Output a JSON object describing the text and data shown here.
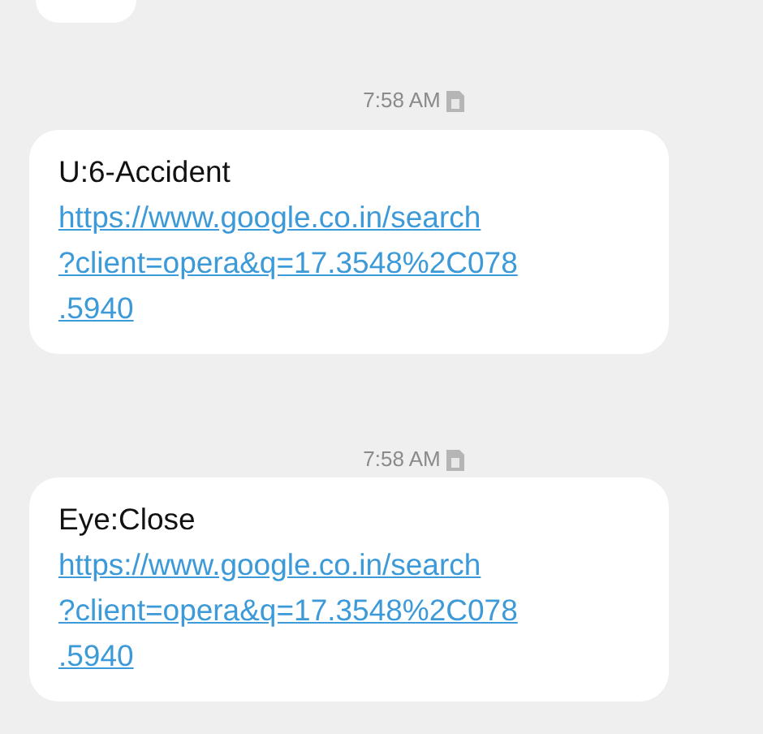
{
  "messages": [
    {
      "time": "7:58 AM",
      "text": "U:6-Accident",
      "link_lines": [
        "https://www.google.co.in/search",
        "?client=opera&q=17.3548%2C078",
        ".5940"
      ]
    },
    {
      "time": "7:58 AM",
      "text": "Eye:Close",
      "link_lines": [
        "https://www.google.co.in/search",
        "?client=opera&q=17.3548%2C078",
        ".5940"
      ]
    }
  ]
}
